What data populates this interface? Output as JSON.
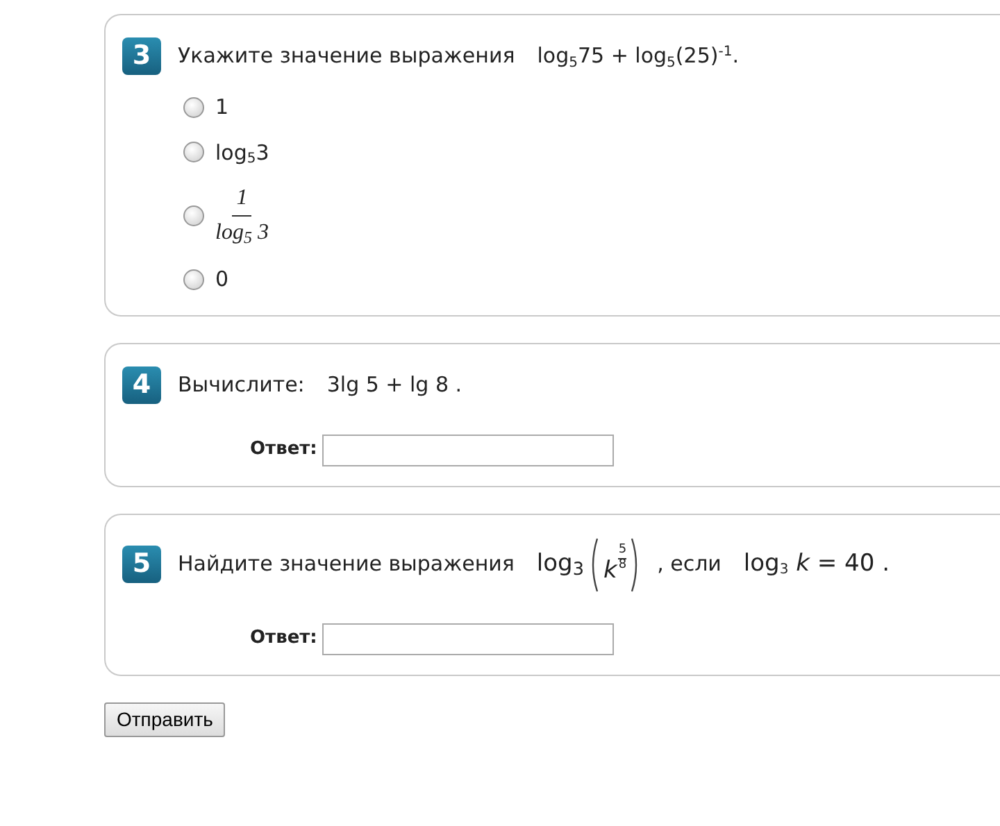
{
  "questions": [
    {
      "number": "3",
      "kind": "choice",
      "prompt": "Укажите значение выражения",
      "formula": "log$_{5}$75 + log$_{5}$(25)$^{-1}$.",
      "options": [
        {
          "kind": "text",
          "text": "1",
          "selected": false
        },
        {
          "kind": "text",
          "text": "log$_{5}$3",
          "selected": false
        },
        {
          "kind": "fraction",
          "numerator": "1",
          "denominator": "log$_{5}$ 3",
          "selected": false
        },
        {
          "kind": "text",
          "text": "0",
          "selected": false
        }
      ]
    },
    {
      "number": "4",
      "kind": "answer",
      "prompt": "Вычислите:",
      "formula": "3lg 5 + lg 8 .",
      "answer_label": "Ответ:"
    },
    {
      "number": "5",
      "kind": "answer",
      "prompt": "Найдите значение выражения",
      "power_formula": {
        "func": "log$_{3}$",
        "base": "k",
        "exp_numerator": "5",
        "exp_denominator": "8"
      },
      "connector": ", если",
      "formula": "log$_{3}$ *k* = 40 .",
      "answer_label": "Ответ:"
    }
  ],
  "submit": "Отправить"
}
